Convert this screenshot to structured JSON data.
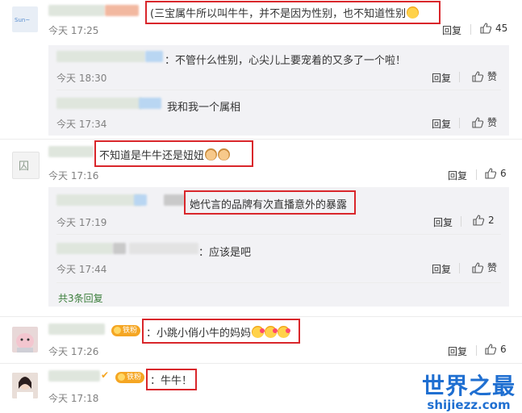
{
  "comments": [
    {
      "text": "(三宝属牛所以叫牛牛，并不是因为性别，也不知道性别",
      "time": "今天 17:25",
      "reply_label": "回复",
      "likes": "45",
      "replies": [
        {
          "text": "：不管什么性别，心尖儿上要宠着的又多了一个啦！",
          "time": "今天 18:30",
          "reply_label": "回复",
          "likes": "赞"
        },
        {
          "text": "我和我一个属相",
          "time": "今天 17:34",
          "reply_label": "回复",
          "likes": "赞"
        }
      ]
    },
    {
      "text": "不知道是牛牛还是妞妞",
      "time": "今天 17:16",
      "reply_label": "回复",
      "likes": "6",
      "replies": [
        {
          "text": "她代言的品牌有次直播意外的暴露",
          "time": "今天 17:19",
          "reply_label": "回复",
          "likes": "2"
        },
        {
          "text": "应该是吧",
          "time": "今天 17:44",
          "reply_label": "回复",
          "likes": "赞"
        }
      ],
      "more_replies": "共3条回复"
    },
    {
      "badge": "铁粉",
      "text": "小跳小俏小牛的妈妈",
      "time": "今天 17:26",
      "reply_label": "回复",
      "likes": "6"
    },
    {
      "badge": "铁粉",
      "text": "：牛牛！",
      "time": "今天 17:18"
    }
  ],
  "watermark": {
    "title": "世界之最",
    "url": "shijiezz.com"
  },
  "colors": {
    "highlight_border": "#d9262b",
    "reply_bg": "#f2f2f5",
    "watermark": "#1f6fd1"
  }
}
